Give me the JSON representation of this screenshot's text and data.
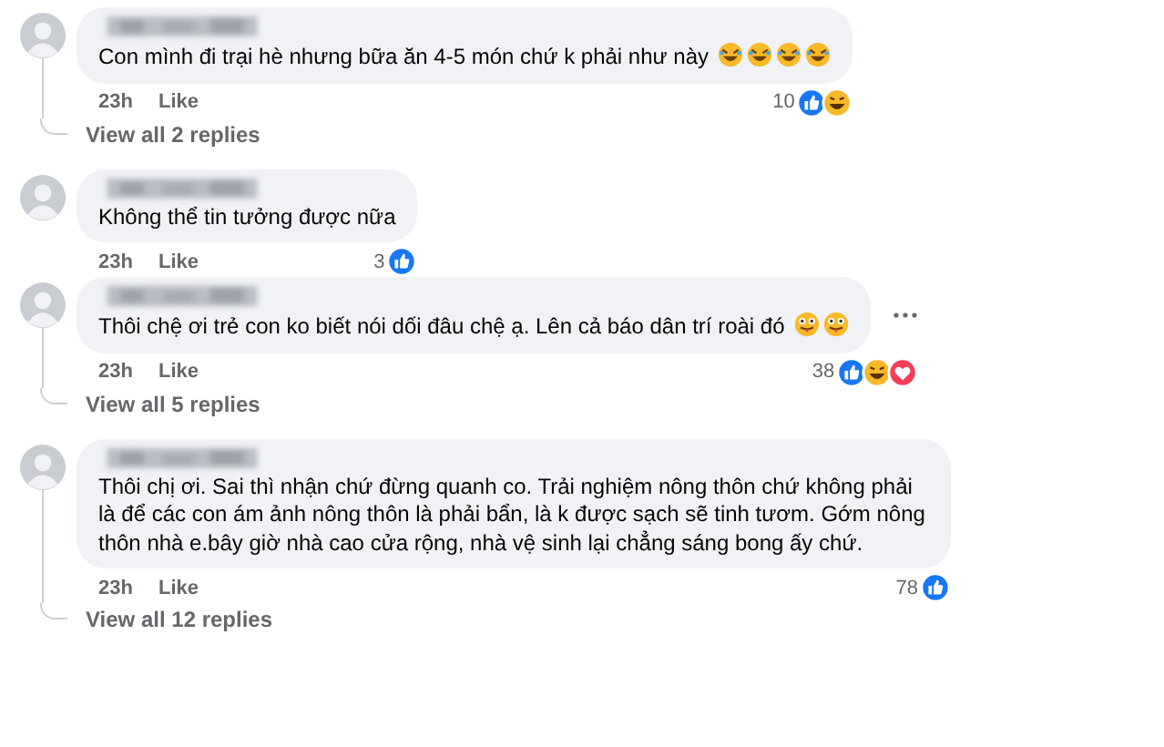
{
  "comments": [
    {
      "text": "Con mình đi trại hè nhưng bữa ăn 4-5 món chứ k phải như này",
      "emojis": [
        {
          "kind": "rofl"
        },
        {
          "kind": "rofl"
        },
        {
          "kind": "rofl"
        },
        {
          "kind": "rofl"
        }
      ],
      "time": "23h",
      "like_label": "Like",
      "reaction_count": "10",
      "reactions": [
        {
          "kind": "like"
        },
        {
          "kind": "haha"
        }
      ],
      "has_menu": false,
      "replies_label": "View all 2 replies"
    },
    {
      "text": "Không thể tin tưởng được nữa",
      "time": "23h",
      "like_label": "Like",
      "reaction_count": "3",
      "reactions": [
        {
          "kind": "like"
        }
      ],
      "has_menu": false
    },
    {
      "text": "Thôi chệ ơi trẻ con ko biết nói dối đâu chệ ạ. Lên cả báo dân trí roài đó",
      "emojis": [
        {
          "kind": "tongue"
        },
        {
          "kind": "tongue"
        }
      ],
      "time": "23h",
      "like_label": "Like",
      "reaction_count": "38",
      "reactions": [
        {
          "kind": "like"
        },
        {
          "kind": "haha"
        },
        {
          "kind": "love"
        }
      ],
      "has_menu": true,
      "replies_label": "View all 5 replies"
    },
    {
      "text": "Thôi chị ơi. Sai thì nhận chứ đừng quanh co. Trải nghiệm nông thôn chứ không phải là để các con ám ảnh nông thôn là phải bẩn, là k được sạch sẽ tinh tươm. Gớm nông thôn nhà e.bây giờ nhà cao cửa rộng, nhà vệ sinh lại chẳng sáng bong ấy chứ.",
      "time": "23h",
      "like_label": "Like",
      "reaction_count": "78",
      "reactions": [
        {
          "kind": "like"
        }
      ],
      "has_menu": false,
      "replies_label": "View all 12 replies"
    }
  ]
}
